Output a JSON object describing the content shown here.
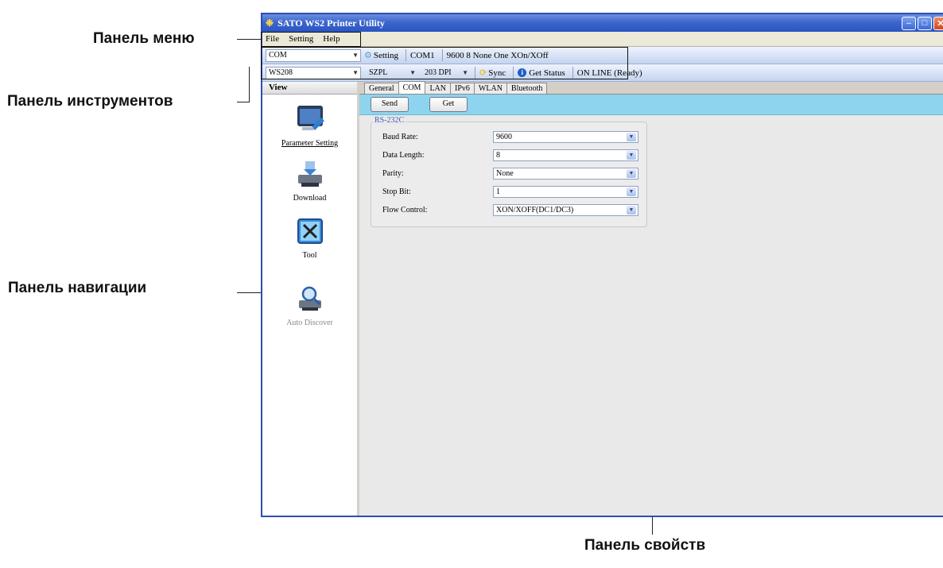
{
  "annotations": {
    "menu_panel": "Панель меню",
    "toolbar_panel": "Панель инструментов",
    "nav_panel": "Панель навигации",
    "properties_panel": "Панель свойств"
  },
  "window": {
    "title": "SATO WS2 Printer Utility",
    "controls": {
      "minimize": "–",
      "maximize": "□",
      "close": "✕"
    }
  },
  "menu": [
    "File",
    "Setting",
    "Help"
  ],
  "toolbar1": {
    "port": "COM",
    "setting_label": "Setting",
    "port_name": "COM1",
    "port_params": "9600 8 None One XOn/XOff"
  },
  "toolbar2": {
    "model": "WS208",
    "language": "SZPL",
    "dpi": "203 DPI",
    "sync_label": "Sync",
    "get_status_label": "Get Status",
    "status": "ON LINE (Ready)"
  },
  "nav": {
    "header": "View",
    "items": [
      {
        "label": "Parameter Setting",
        "icon": "parameter-setting-icon"
      },
      {
        "label": "Download",
        "icon": "download-printer-icon"
      },
      {
        "label": "Tool",
        "icon": "tool-icon"
      },
      {
        "label": "Auto Discover",
        "icon": "auto-discover-icon"
      }
    ]
  },
  "tabs": [
    "General",
    "COM",
    "LAN",
    "IPv6",
    "WLAN",
    "Bluetooth"
  ],
  "active_tab": "COM",
  "actions": {
    "send": "Send",
    "get": "Get"
  },
  "group": {
    "title": "RS-232C",
    "fields": [
      {
        "label": "Baud Rate:",
        "value": "9600"
      },
      {
        "label": "Data Length:",
        "value": "8"
      },
      {
        "label": "Parity:",
        "value": "None"
      },
      {
        "label": "Stop Bit:",
        "value": "1"
      },
      {
        "label": "Flow Control:",
        "value": "XON/XOFF(DC1/DC3)"
      }
    ]
  },
  "colors": {
    "titlebar": "#2a55c2",
    "accent_bar": "#8fd4ee",
    "group_title": "#3b5fb8"
  }
}
